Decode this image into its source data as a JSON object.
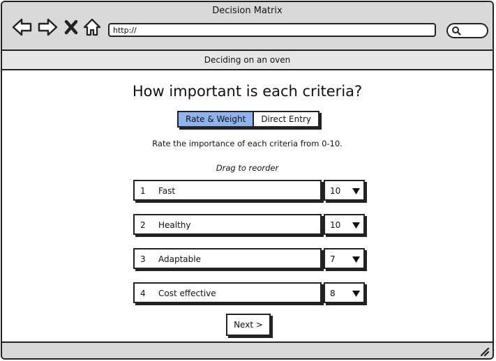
{
  "window": {
    "title": "Decision Matrix",
    "address_placeholder": "http://",
    "icons": [
      "back-arrow-icon",
      "forward-arrow-icon",
      "close-x-icon",
      "home-icon",
      "search-icon"
    ]
  },
  "page": {
    "subtitle": "Deciding on an oven",
    "heading": "How important is each criteria?",
    "tabs": [
      {
        "label": "Rate & Weight",
        "active": true
      },
      {
        "label": "Direct Entry",
        "active": false
      }
    ],
    "description": "Rate the importance of each criteria from 0-10.",
    "hint": "Drag to reorder",
    "criteria": [
      {
        "number": "1",
        "label": "Fast",
        "value": "10"
      },
      {
        "number": "2",
        "label": "Healthy",
        "value": "10"
      },
      {
        "number": "3",
        "label": "Adaptable",
        "value": "7"
      },
      {
        "number": "4",
        "label": "Cost effective",
        "value": "8"
      }
    ],
    "next_label": "Next >"
  },
  "colors": {
    "active_tab": "#8fb3ee",
    "chrome": "#d9d9d9",
    "subbar": "#e6e6e6",
    "outline": "#222222"
  }
}
